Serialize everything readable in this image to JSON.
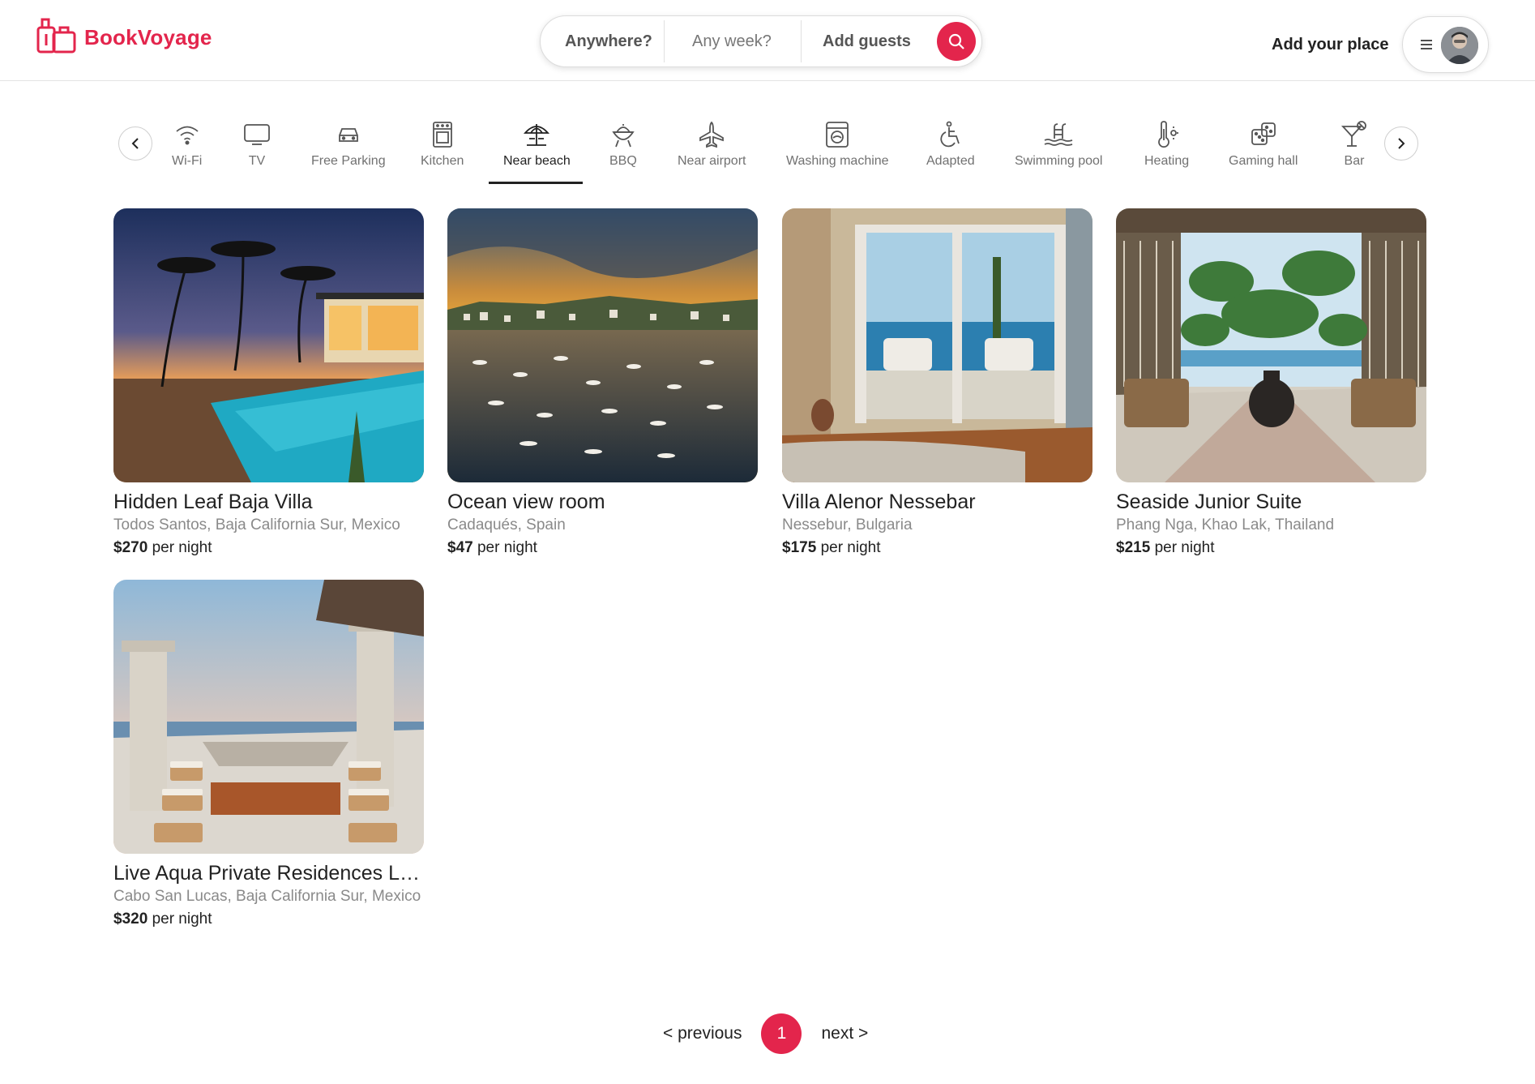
{
  "brand": {
    "name": "BookVoyage",
    "color": "#e3254c"
  },
  "search": {
    "where": "Anywhere?",
    "when": "Any week?",
    "who": "Add guests"
  },
  "header": {
    "add_place": "Add your place"
  },
  "categories": [
    {
      "label": "Wi-Fi",
      "icon": "wifi-icon"
    },
    {
      "label": "TV",
      "icon": "tv-icon"
    },
    {
      "label": "Free Parking",
      "icon": "car-icon"
    },
    {
      "label": "Kitchen",
      "icon": "oven-icon"
    },
    {
      "label": "Near beach",
      "icon": "beach-umbrella-icon",
      "active": true
    },
    {
      "label": "BBQ",
      "icon": "grill-icon"
    },
    {
      "label": "Near airport",
      "icon": "airplane-icon"
    },
    {
      "label": "Washing machine",
      "icon": "washing-machine-icon"
    },
    {
      "label": "Adapted",
      "icon": "wheelchair-icon"
    },
    {
      "label": "Swimming pool",
      "icon": "pool-ladder-icon"
    },
    {
      "label": "Heating",
      "icon": "thermometer-icon"
    },
    {
      "label": "Gaming hall",
      "icon": "dice-icon"
    },
    {
      "label": "Bar",
      "icon": "cocktail-icon"
    }
  ],
  "listings": [
    {
      "title": "Hidden Leaf Baja Villa",
      "location": "Todos Santos, Baja California Sur, Mexico",
      "price": "$270",
      "unit": "per night"
    },
    {
      "title": "Ocean view room",
      "location": "Cadaqués, Spain",
      "price": "$47",
      "unit": "per night"
    },
    {
      "title": "Villa Alenor Nessebar",
      "location": "Nessebur, Bulgaria",
      "price": "$175",
      "unit": "per night"
    },
    {
      "title": "Seaside Junior Suite",
      "location": "Phang Nga, Khao Lak, Thailand",
      "price": "$215",
      "unit": "per night"
    },
    {
      "title": "Live Aqua Private Residences Los Cabos",
      "location": "Cabo San Lucas, Baja California Sur, Mexico",
      "price": "$320",
      "unit": "per night"
    }
  ],
  "pagination": {
    "previous": "< previous",
    "current": "1",
    "next": "next >"
  }
}
